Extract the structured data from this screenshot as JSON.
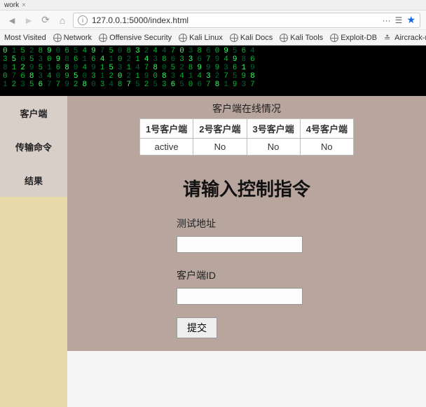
{
  "browser": {
    "tab_label_fragment": "work",
    "url": "127.0.0.1:5000/index.html",
    "reader_dots": "···",
    "bookmarks": [
      "Most Visited",
      "Network",
      "Offensive Security",
      "Kali Linux",
      "Kali Docs",
      "Kali Tools",
      "Exploit-DB",
      "Aircrack-ng"
    ]
  },
  "matrix_rows": [
    "0 1 5 2 8 9 0 6 5 4 9 7 5 0 8 3 2 4 4 7 0 3 8 6 0 9 5 6 4",
    "3 5 0 5 3 0 9 8 6 1 6 4 1 0 2 1 4 3 8 6 3 3 6 7 9 4 9 8 6",
    "8 1 2 9 5 1 6 8 0 4 9 1 5 3 1 4 7 8 0 5 2 8 9 9 9 3 6 1 9",
    "0 7 6 8 3 4 0 9 5 0 3 1 2 0 2 1 9 0 8 3 4 1 4 3 2 7 5 9 8",
    "1 2 3 5 6 7 7 9 2 8 0 3 4 8 7 5 2 5 3 6 5 0 6 7 8 1 9 3 7"
  ],
  "sidebar": {
    "items": [
      {
        "label": "客户端"
      },
      {
        "label": "传输命令"
      },
      {
        "label": "结果"
      }
    ]
  },
  "status": {
    "title": "客户端在线情况",
    "headers": [
      "1号客户端",
      "2号客户端",
      "3号客户端",
      "4号客户端"
    ],
    "row": [
      "active",
      "No",
      "No",
      "No"
    ]
  },
  "main": {
    "heading": "请输入控制指令",
    "field1_label": "测试地址",
    "field1_value": "",
    "field2_label": "客户端ID",
    "field2_value": "",
    "submit_label": "提交"
  }
}
